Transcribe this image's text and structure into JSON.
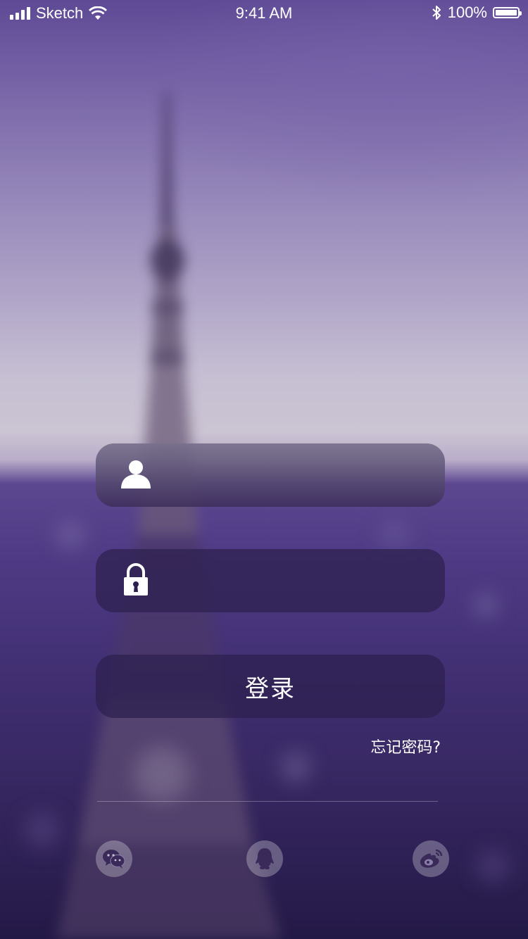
{
  "status_bar": {
    "carrier": "Sketch",
    "time": "9:41 AM",
    "battery": "100%",
    "icons": [
      "signal-icon",
      "wifi-icon",
      "bluetooth-icon",
      "battery-icon"
    ]
  },
  "form": {
    "username": {
      "value": "",
      "placeholder": "",
      "icon": "user-icon"
    },
    "password": {
      "value": "",
      "placeholder": "",
      "icon": "lock-icon"
    },
    "login_label": "登录",
    "forgot_password": "忘记密码?"
  },
  "social_login": [
    {
      "icon": "wechat-icon"
    },
    {
      "icon": "qq-icon"
    },
    {
      "icon": "weibo-icon"
    }
  ],
  "colors": {
    "accent": "#4e3a84",
    "text": "#ffffff",
    "button_bg": "#2d204e"
  }
}
